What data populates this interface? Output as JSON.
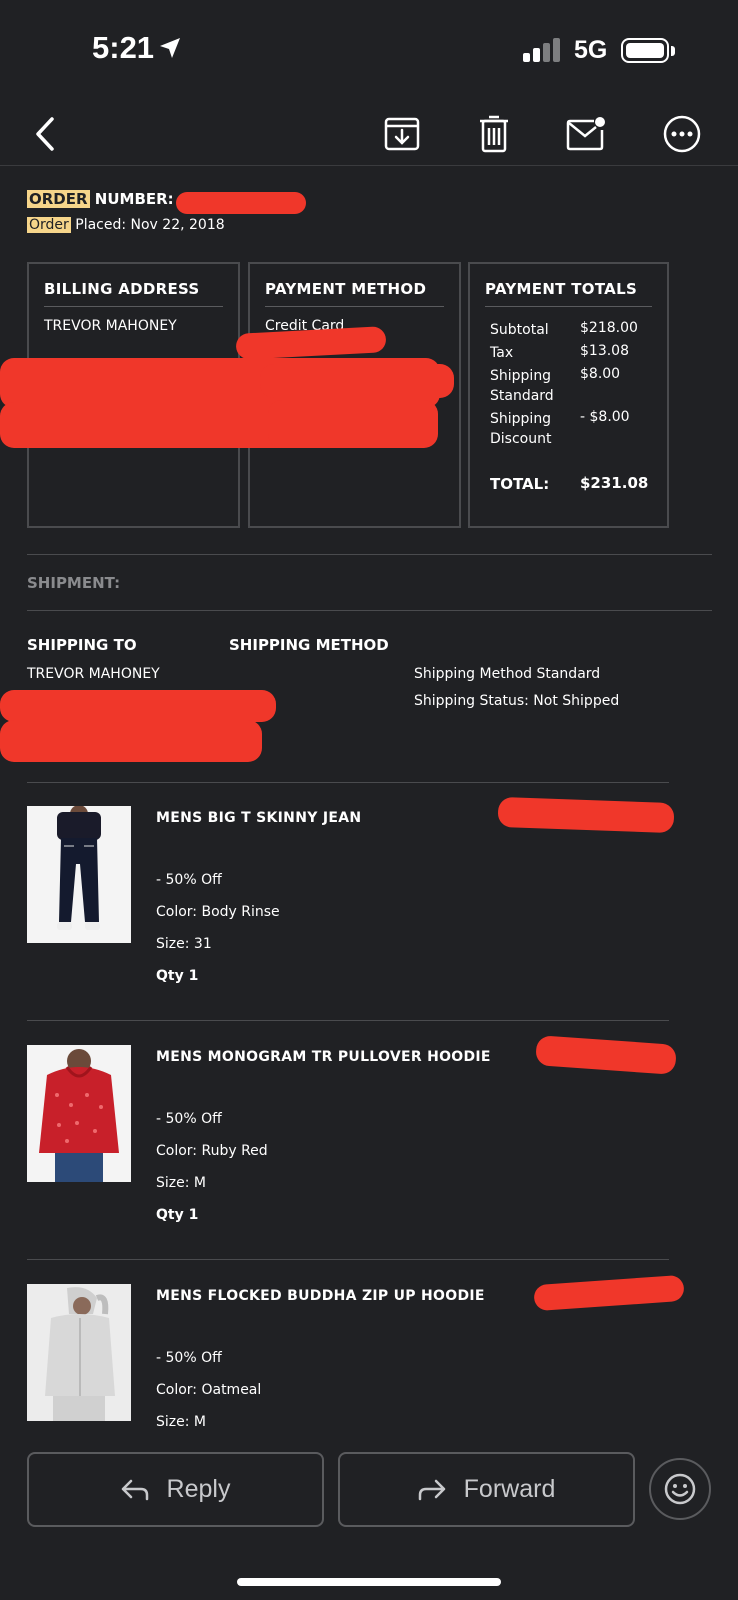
{
  "status_bar": {
    "time": "5:21",
    "network": "5G"
  },
  "toolbar": {
    "icons": [
      "back-icon",
      "archive-icon",
      "trash-icon",
      "mark-unread-icon",
      "more-icon"
    ]
  },
  "order": {
    "number_label": "ORDER",
    "number_rest": " NUMBER:",
    "placed_hl": "Order",
    "placed_rest": " Placed: Nov 22, 2018"
  },
  "billing": {
    "title": "BILLING ADDRESS",
    "name": "TREVOR MAHONEY"
  },
  "payment": {
    "title": "PAYMENT METHOD",
    "method": "Credit Card"
  },
  "totals": {
    "title": "PAYMENT TOTALS",
    "subtotal_label": "Subtotal",
    "subtotal": "$218.00",
    "tax_label": "Tax",
    "tax": "$13.08",
    "shipping_label_1": "Shipping",
    "shipping_label_2": "Standard",
    "shipping": "$8.00",
    "discount_label_1": "Shipping",
    "discount_label_2": "Discount",
    "discount": "- $8.00",
    "total_label": "TOTAL:",
    "total": "$231.08"
  },
  "shipment": {
    "label": "SHIPMENT:",
    "to_label": "SHIPPING TO",
    "method_label": "SHIPPING METHOD",
    "name": "TREVOR MAHONEY",
    "method": "Shipping Method Standard",
    "status": "Shipping Status: Not Shipped"
  },
  "items": [
    {
      "name": "MENS BIG T SKINNY JEAN",
      "discount": "- 50% Off",
      "color": "Color: Body Rinse",
      "size": "Size: 31",
      "qty": "Qty 1"
    },
    {
      "name": "MENS MONOGRAM TR PULLOVER HOODIE",
      "discount": "- 50% Off",
      "color": "Color: Ruby Red",
      "size": "Size: M",
      "qty": "Qty 1"
    },
    {
      "name": "MENS FLOCKED BUDDHA ZIP UP HOODIE",
      "discount": "- 50% Off",
      "color": "Color: Oatmeal",
      "size": "Size: M"
    }
  ],
  "actions": {
    "reply": "Reply",
    "forward": "Forward"
  },
  "colors": {
    "background": "#202124",
    "highlight": "#f6d58a",
    "redaction": "#f0372a",
    "border": "#4a4b4e"
  }
}
